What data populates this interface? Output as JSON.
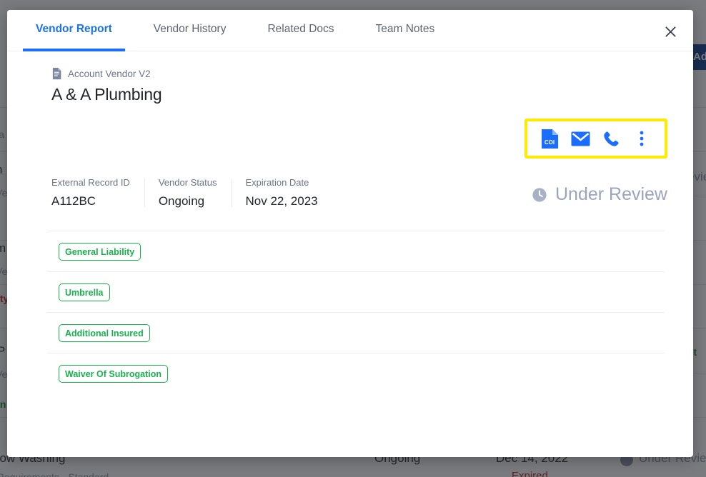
{
  "background": {
    "add_button_label": "Add Ve",
    "rows": [
      {
        "name": "ila",
        "status": "",
        "date": "",
        "badge": ""
      },
      {
        "name": "n",
        "status": "Ve",
        "date": "",
        "badge": "evie"
      },
      {
        "name": "m",
        "status": "Ve",
        "date": "",
        "badge": ""
      },
      {
        "name": "ity",
        "status": "",
        "date": "",
        "badge": ""
      },
      {
        "name": "P",
        "status": "Ve",
        "date": "",
        "badge": "nt"
      },
      {
        "name": "in",
        "status": "",
        "date": "",
        "badge": ""
      },
      {
        "name": "dow Washing",
        "status": "Ongoing",
        "date": "Dec 14, 2022",
        "badge": "Under Review"
      },
      {
        "name": "t Requirements - Standard",
        "status": "",
        "date": "Expired",
        "badge": ""
      }
    ]
  },
  "modal": {
    "tabs": [
      {
        "label": "Vendor Report",
        "active": true
      },
      {
        "label": "Vendor History",
        "active": false
      },
      {
        "label": "Related Docs",
        "active": false
      },
      {
        "label": "Team Notes",
        "active": false
      }
    ],
    "close_label": "✕",
    "record_type": "Account Vendor V2",
    "vendor_name": "A & A Plumbing",
    "actions": [
      {
        "name": "coi-document-icon",
        "label": "COI"
      },
      {
        "name": "email-icon",
        "label": "Email"
      },
      {
        "name": "phone-icon",
        "label": "Call"
      },
      {
        "name": "more-options-icon",
        "label": "More"
      }
    ],
    "meta": [
      {
        "label": "External Record ID",
        "value": "A112BC"
      },
      {
        "label": "Vendor Status",
        "value": "Ongoing"
      },
      {
        "label": "Expiration Date",
        "value": "Nov 22, 2023"
      }
    ],
    "status": {
      "icon": "clock-icon",
      "text": "Under Review"
    },
    "coverages": [
      {
        "label": "General Liability"
      },
      {
        "label": "Umbrella"
      },
      {
        "label": "Additional Insured"
      },
      {
        "label": "Waiver Of Subrogation"
      }
    ]
  },
  "colors": {
    "accent_blue": "#1a6dff",
    "tag_green": "#17b24c",
    "status_gray": "#9aa4bb",
    "highlight_yellow": "#ffeb00",
    "add_button_blue": "#0b3d91"
  }
}
